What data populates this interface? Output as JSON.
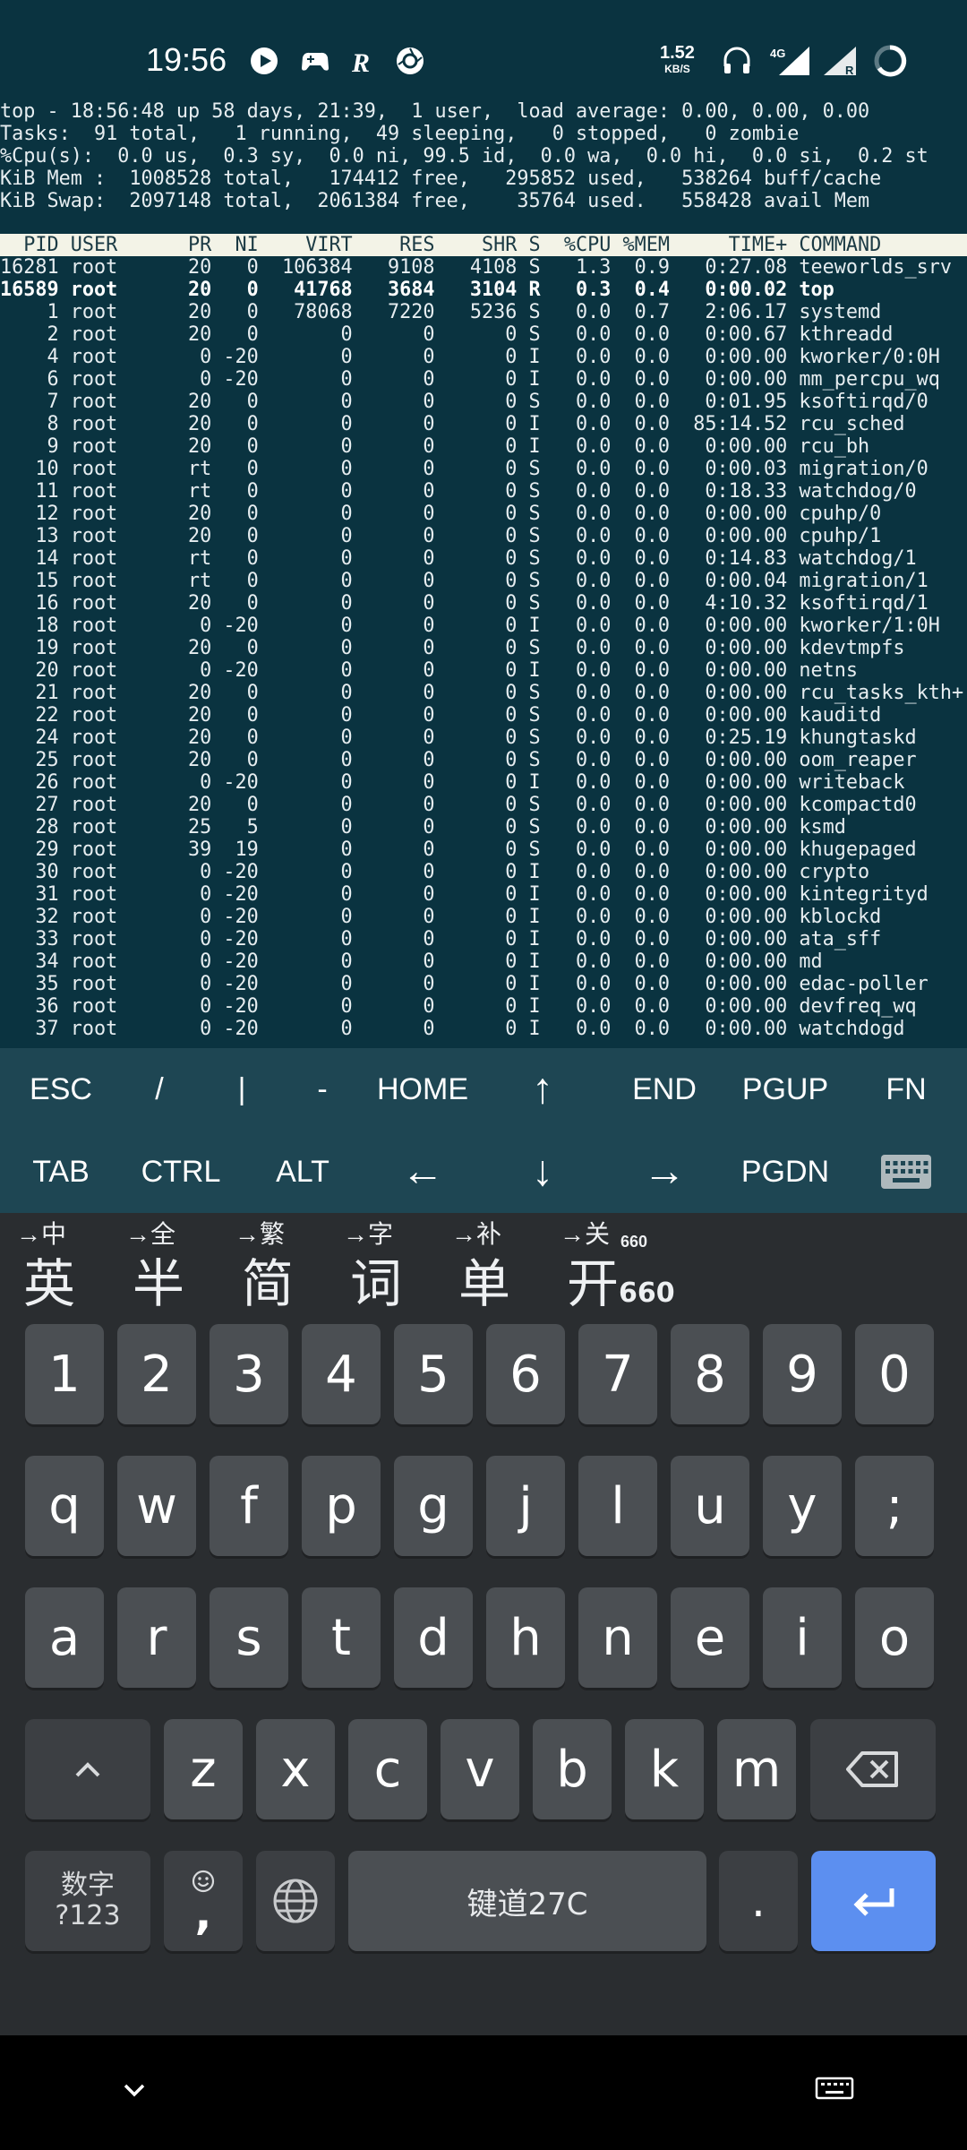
{
  "status_bar": {
    "time": "19:56",
    "net_speed_value": "1.52",
    "net_speed_unit": "KB/S",
    "icons": [
      "media-play-icon",
      "game-controller-icon",
      "r-app-icon",
      "aperture-icon",
      "headphones-icon",
      "signal-4g-icon",
      "signal-r-icon",
      "battery-ring-icon"
    ],
    "network_label": "4G",
    "roaming_label": "R"
  },
  "terminal": {
    "summary": [
      "top - 18:56:48 up 58 days, 21:39,  1 user,  load average: 0.00, 0.00, 0.00",
      "Tasks:  91 total,   1 running,  49 sleeping,   0 stopped,   0 zombie",
      "%Cpu(s):  0.0 us,  0.3 sy,  0.0 ni, 99.5 id,  0.0 wa,  0.0 hi,  0.0 si,  0.2 st",
      "KiB Mem :  1008528 total,   174412 free,   295852 used,   538264 buff/cache",
      "KiB Swap:  2097148 total,  2061384 free,    35764 used.   558428 avail Mem"
    ],
    "process_header": "  PID USER      PR  NI    VIRT    RES    SHR S  %CPU %MEM     TIME+ COMMAND          ",
    "processes": [
      {
        "line": "16281 root      20   0  106384   9108   4108 S   1.3  0.9   0:27.08 teeworlds_srv",
        "bold": false
      },
      {
        "line": "16589 root      20   0   41768   3684   3104 R   0.3  0.4   0:00.02 top",
        "bold": true
      },
      {
        "line": "    1 root      20   0   78068   7220   5236 S   0.0  0.7   2:06.17 systemd",
        "bold": false
      },
      {
        "line": "    2 root      20   0       0      0      0 S   0.0  0.0   0:00.67 kthreadd",
        "bold": false
      },
      {
        "line": "    4 root       0 -20       0      0      0 I   0.0  0.0   0:00.00 kworker/0:0H",
        "bold": false
      },
      {
        "line": "    6 root       0 -20       0      0      0 I   0.0  0.0   0:00.00 mm_percpu_wq",
        "bold": false
      },
      {
        "line": "    7 root      20   0       0      0      0 S   0.0  0.0   0:01.95 ksoftirqd/0",
        "bold": false
      },
      {
        "line": "    8 root      20   0       0      0      0 I   0.0  0.0  85:14.52 rcu_sched",
        "bold": false
      },
      {
        "line": "    9 root      20   0       0      0      0 I   0.0  0.0   0:00.00 rcu_bh",
        "bold": false
      },
      {
        "line": "   10 root      rt   0       0      0      0 S   0.0  0.0   0:00.03 migration/0",
        "bold": false
      },
      {
        "line": "   11 root      rt   0       0      0      0 S   0.0  0.0   0:18.33 watchdog/0",
        "bold": false
      },
      {
        "line": "   12 root      20   0       0      0      0 S   0.0  0.0   0:00.00 cpuhp/0",
        "bold": false
      },
      {
        "line": "   13 root      20   0       0      0      0 S   0.0  0.0   0:00.00 cpuhp/1",
        "bold": false
      },
      {
        "line": "   14 root      rt   0       0      0      0 S   0.0  0.0   0:14.83 watchdog/1",
        "bold": false
      },
      {
        "line": "   15 root      rt   0       0      0      0 S   0.0  0.0   0:00.04 migration/1",
        "bold": false
      },
      {
        "line": "   16 root      20   0       0      0      0 S   0.0  0.0   4:10.32 ksoftirqd/1",
        "bold": false
      },
      {
        "line": "   18 root       0 -20       0      0      0 I   0.0  0.0   0:00.00 kworker/1:0H",
        "bold": false
      },
      {
        "line": "   19 root      20   0       0      0      0 S   0.0  0.0   0:00.00 kdevtmpfs",
        "bold": false
      },
      {
        "line": "   20 root       0 -20       0      0      0 I   0.0  0.0   0:00.00 netns",
        "bold": false
      },
      {
        "line": "   21 root      20   0       0      0      0 S   0.0  0.0   0:00.00 rcu_tasks_kth+",
        "bold": false
      },
      {
        "line": "   22 root      20   0       0      0      0 S   0.0  0.0   0:00.00 kauditd",
        "bold": false
      },
      {
        "line": "   24 root      20   0       0      0      0 S   0.0  0.0   0:25.19 khungtaskd",
        "bold": false
      },
      {
        "line": "   25 root      20   0       0      0      0 S   0.0  0.0   0:00.00 oom_reaper",
        "bold": false
      },
      {
        "line": "   26 root       0 -20       0      0      0 I   0.0  0.0   0:00.00 writeback",
        "bold": false
      },
      {
        "line": "   27 root      20   0       0      0      0 S   0.0  0.0   0:00.00 kcompactd0",
        "bold": false
      },
      {
        "line": "   28 root      25   5       0      0      0 S   0.0  0.0   0:00.00 ksmd",
        "bold": false
      },
      {
        "line": "   29 root      39  19       0      0      0 S   0.0  0.0   0:00.00 khugepaged",
        "bold": false
      },
      {
        "line": "   30 root       0 -20       0      0      0 I   0.0  0.0   0:00.00 crypto",
        "bold": false
      },
      {
        "line": "   31 root       0 -20       0      0      0 I   0.0  0.0   0:00.00 kintegrityd",
        "bold": false
      },
      {
        "line": "   32 root       0 -20       0      0      0 I   0.0  0.0   0:00.00 kblockd",
        "bold": false
      },
      {
        "line": "   33 root       0 -20       0      0      0 I   0.0  0.0   0:00.00 ata_sff",
        "bold": false
      },
      {
        "line": "   34 root       0 -20       0      0      0 I   0.0  0.0   0:00.00 md",
        "bold": false
      },
      {
        "line": "   35 root       0 -20       0      0      0 I   0.0  0.0   0:00.00 edac-poller",
        "bold": false
      },
      {
        "line": "   36 root       0 -20       0      0      0 I   0.0  0.0   0:00.00 devfreq_wq",
        "bold": false
      },
      {
        "line": "   37 root       0 -20       0      0      0 I   0.0  0.0   0:00.00 watchdogd",
        "bold": false
      }
    ]
  },
  "extra_keys": {
    "row1": [
      "ESC",
      "/",
      "|",
      "-",
      "HOME",
      "↑",
      "END",
      "PGUP",
      "FN"
    ],
    "row2": [
      "TAB",
      "CTRL",
      "ALT",
      "←",
      "↓",
      "→",
      "PGDN"
    ],
    "row2_last_icon": "keyboard-icon"
  },
  "candidates": [
    {
      "hint": "→中",
      "main": "英",
      "sub": ""
    },
    {
      "hint": "→全",
      "main": "半",
      "sub": ""
    },
    {
      "hint": "→繁",
      "main": "简",
      "sub": ""
    },
    {
      "hint": "→字",
      "main": "词",
      "sub": ""
    },
    {
      "hint": "→补",
      "main": "单",
      "sub": ""
    },
    {
      "hint": "→关",
      "hint_sub": "660",
      "main": "开",
      "sub": "660"
    }
  ],
  "keyboard": {
    "row_numbers": [
      "1",
      "2",
      "3",
      "4",
      "5",
      "6",
      "7",
      "8",
      "9",
      "0"
    ],
    "row1": [
      "q",
      "w",
      "f",
      "p",
      "g",
      "j",
      "l",
      "u",
      "y",
      ";"
    ],
    "row2": [
      "a",
      "r",
      "s",
      "t",
      "d",
      "h",
      "n",
      "e",
      "i",
      "o"
    ],
    "row3": [
      "z",
      "x",
      "c",
      "v",
      "b",
      "k",
      "m"
    ],
    "shift_icon": "caret-up-icon",
    "backspace_icon": "backspace-icon",
    "symbols_label_top": "数字",
    "symbols_label_bottom": "?123",
    "comma_label": ",",
    "emoji_icon": "smiley-icon",
    "globe_icon": "globe-icon",
    "space_label": "键道27C",
    "period_label": ".",
    "enter_icon": "enter-arrow-icon"
  },
  "nav_bar": {
    "left_icon": "chevron-down-icon",
    "right_icon": "keyboard-switch-icon"
  }
}
